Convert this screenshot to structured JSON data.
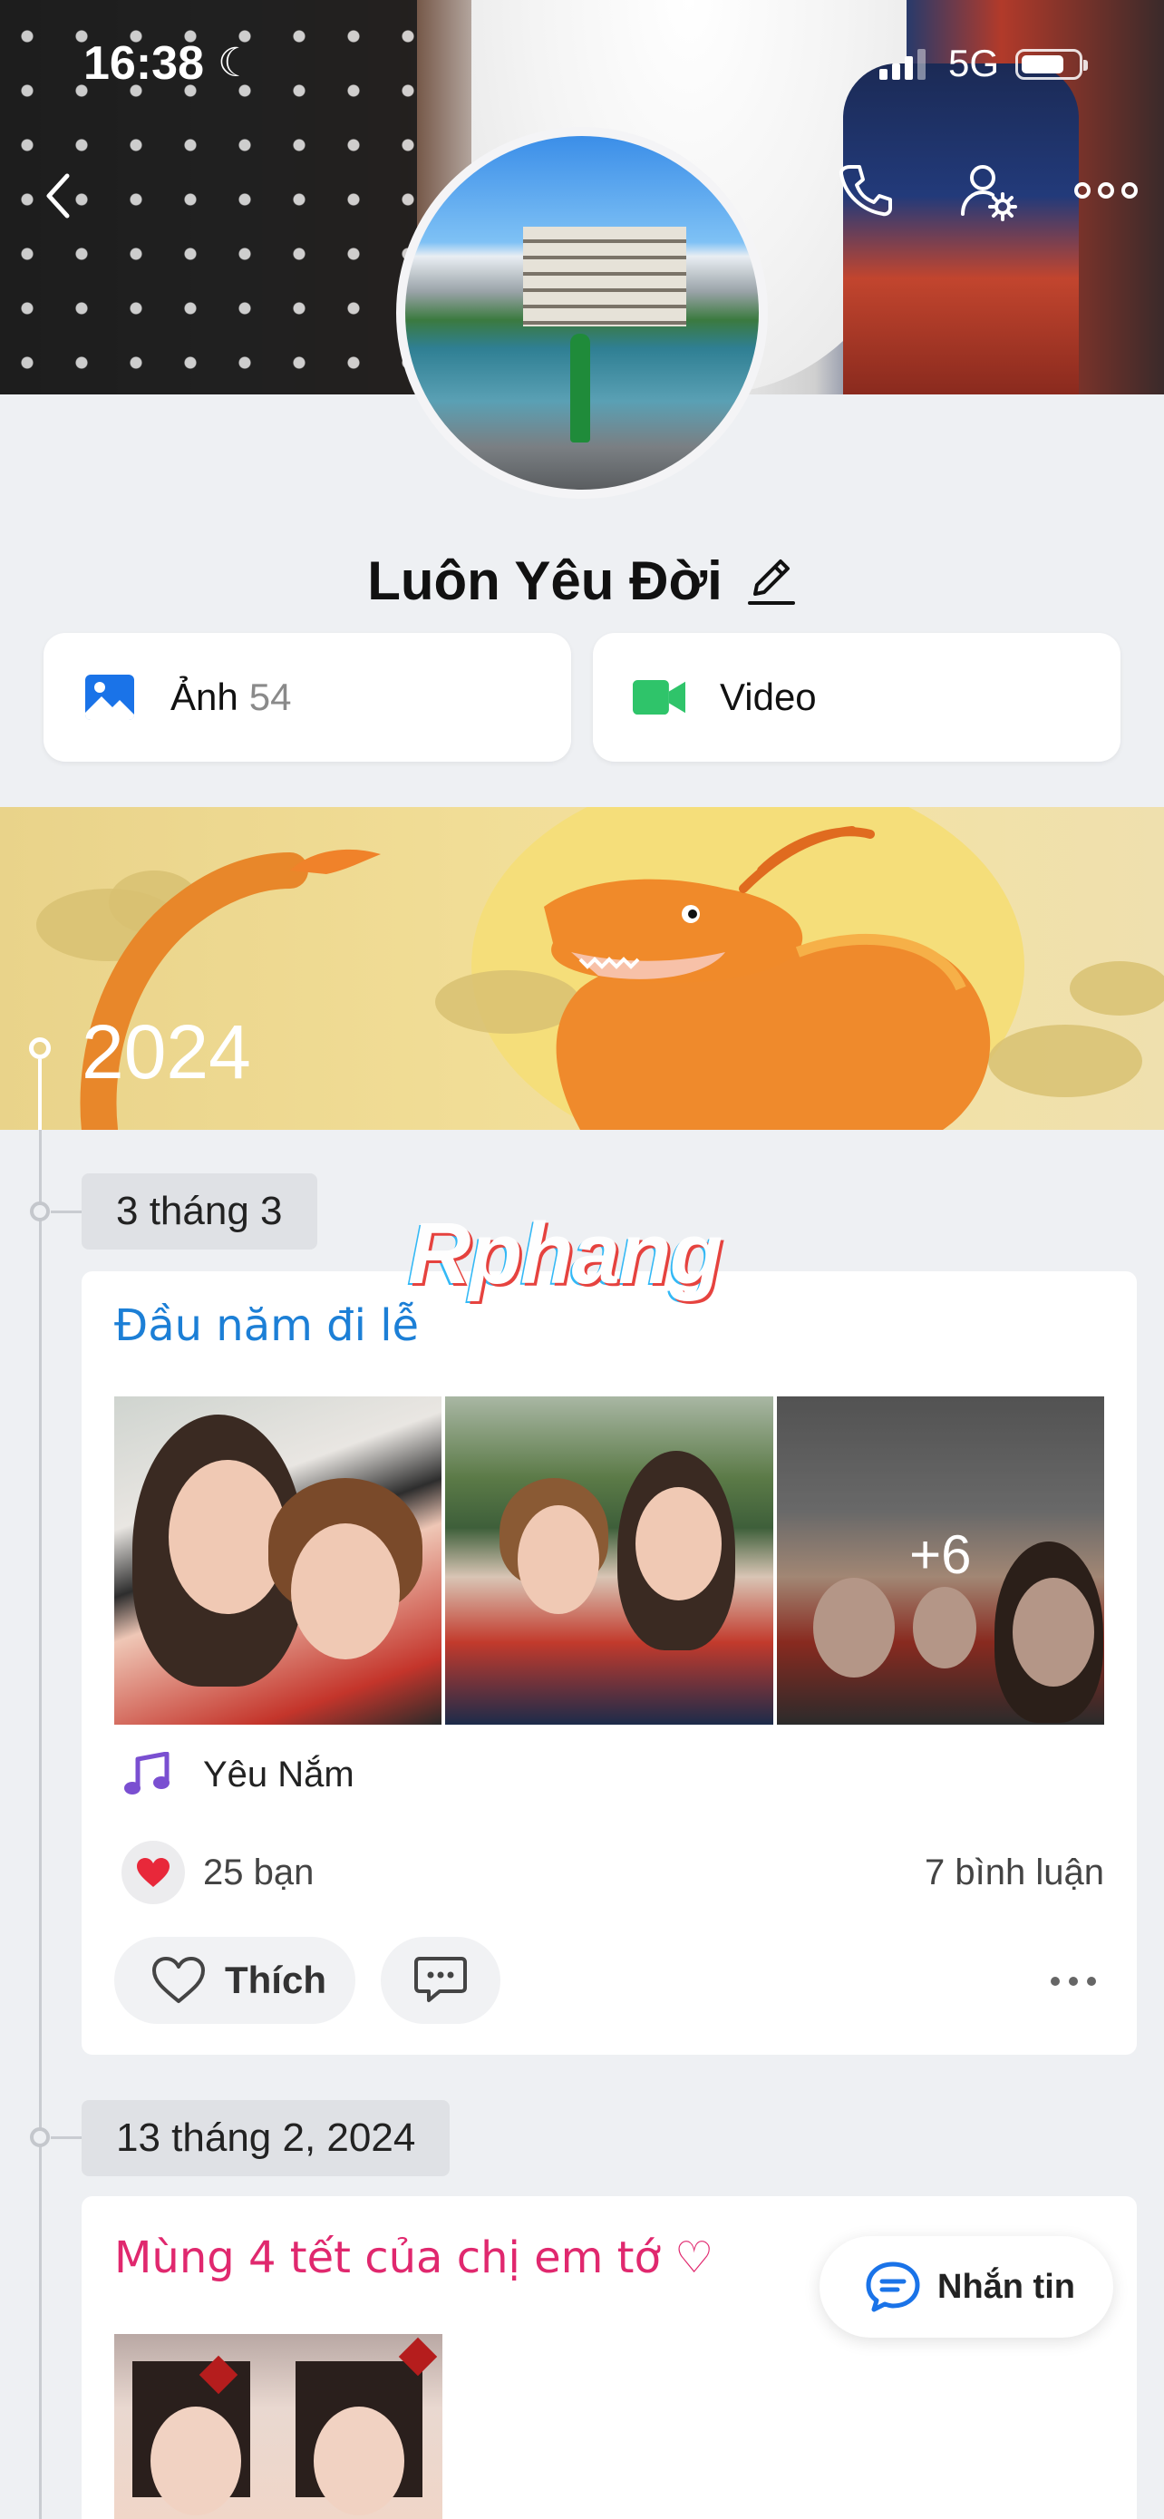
{
  "status_bar": {
    "time": "16:38",
    "network": "5G"
  },
  "profile": {
    "name": "Luôn Yêu Đời"
  },
  "media": {
    "photos_label": "Ảnh",
    "photos_count": "54",
    "videos_label": "Video"
  },
  "timeline": {
    "year": "2024",
    "posts": [
      {
        "date": "3 tháng 3",
        "title": "Đầu năm đi lễ",
        "more_photos": "+6",
        "song": "Yêu Nắm",
        "likes": "25 bạn",
        "comments": "7 bình luận",
        "like_label": "Thích"
      },
      {
        "date": "13 tháng 2, 2024",
        "title": "Mùng 4 tết của chị em tớ ♡"
      }
    ]
  },
  "chat_button": {
    "label": "Nhắn tin"
  },
  "watermark": "Rphang",
  "colors": {
    "title_blue": "#1c7fd6",
    "title_pink": "#e0286e",
    "photo_icon": "#1a73e8",
    "video_icon": "#2fc46a",
    "heart": "#e8283a"
  },
  "icons": [
    "back-icon",
    "phone-icon",
    "profile-settings-icon",
    "more-icon",
    "edit-icon",
    "photo-icon",
    "video-camera-icon",
    "music-note-icon",
    "heart-icon",
    "comment-icon",
    "chat-icon"
  ]
}
